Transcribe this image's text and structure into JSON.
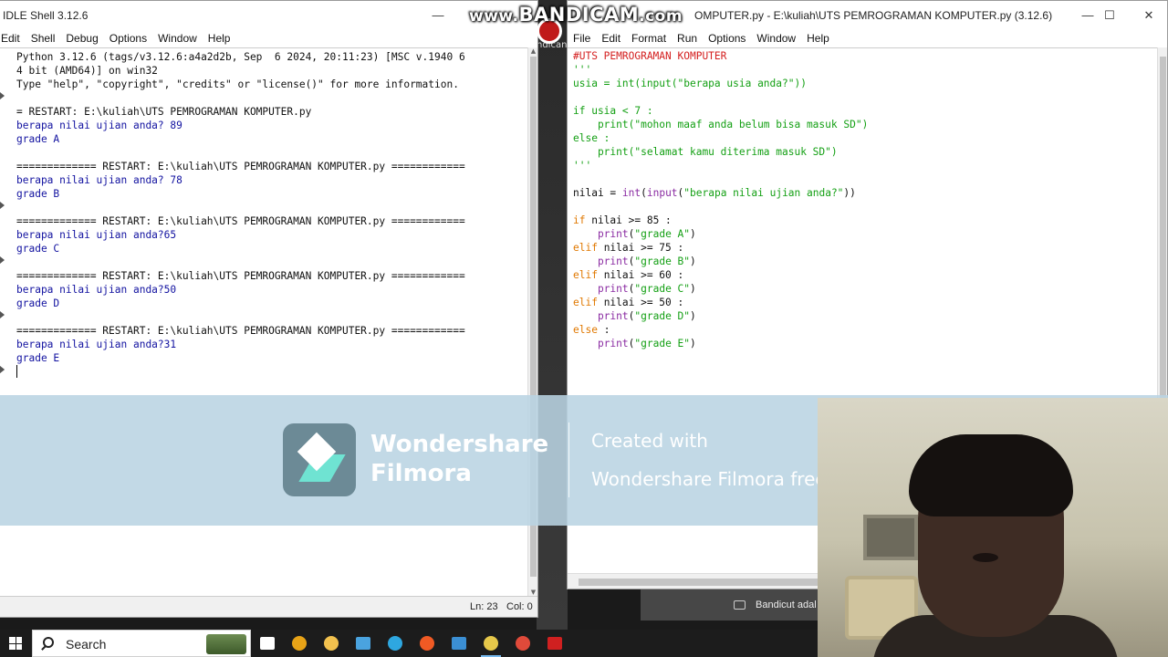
{
  "shell_window": {
    "title": "IDLE Shell 3.12.6",
    "menu": [
      "Edit",
      "Shell",
      "Debug",
      "Options",
      "Window",
      "Help"
    ],
    "lines": [
      {
        "text": "Python 3.12.6 (tags/v3.12.6:a4a2d2b, Sep  6 2024, 20:11:23) [MSC v.1940 6",
        "cls": "c-out"
      },
      {
        "text": "4 bit (AMD64)] on win32",
        "cls": "c-out"
      },
      {
        "text": "Type \"help\", \"copyright\", \"credits\" or \"license()\" for more information.",
        "cls": "c-out"
      },
      {
        "text": "",
        "cls": "c-out"
      },
      {
        "text": "= RESTART: E:\\kuliah\\UTS PEMROGRAMAN KOMPUTER.py",
        "cls": "c-out"
      },
      {
        "text": "berapa nilai ujian anda? 89",
        "cls": "c-blue"
      },
      {
        "text": "grade A",
        "cls": "c-blue"
      },
      {
        "text": "",
        "cls": "c-out"
      },
      {
        "text": "============= RESTART: E:\\kuliah\\UTS PEMROGRAMAN KOMPUTER.py ============",
        "cls": "c-out"
      },
      {
        "text": "berapa nilai ujian anda? 78",
        "cls": "c-blue"
      },
      {
        "text": "grade B",
        "cls": "c-blue"
      },
      {
        "text": "",
        "cls": "c-out"
      },
      {
        "text": "============= RESTART: E:\\kuliah\\UTS PEMROGRAMAN KOMPUTER.py ============",
        "cls": "c-out"
      },
      {
        "text": "berapa nilai ujian anda?65",
        "cls": "c-blue"
      },
      {
        "text": "grade C",
        "cls": "c-blue"
      },
      {
        "text": "",
        "cls": "c-out"
      },
      {
        "text": "============= RESTART: E:\\kuliah\\UTS PEMROGRAMAN KOMPUTER.py ============",
        "cls": "c-out"
      },
      {
        "text": "berapa nilai ujian anda?50",
        "cls": "c-blue"
      },
      {
        "text": "grade D",
        "cls": "c-blue"
      },
      {
        "text": "",
        "cls": "c-out"
      },
      {
        "text": "============= RESTART: E:\\kuliah\\UTS PEMROGRAMAN KOMPUTER.py ============",
        "cls": "c-out"
      },
      {
        "text": "berapa nilai ujian anda?31",
        "cls": "c-blue"
      },
      {
        "text": "grade E",
        "cls": "c-blue"
      }
    ],
    "status": {
      "line": "Ln: 23",
      "col": "Col: 0"
    }
  },
  "editor_window": {
    "title": "OMPUTER.py - E:\\kuliah\\UTS PEMROGRAMAN KOMPUTER.py (3.12.6)",
    "menu": [
      "File",
      "Edit",
      "Format",
      "Run",
      "Options",
      "Window",
      "Help"
    ],
    "code": [
      [
        {
          "t": "#UTS PEMROGRAMAN KOMPUTER",
          "c": "k-red"
        }
      ],
      [
        {
          "t": "'''",
          "c": "k-str"
        }
      ],
      [
        {
          "t": "usia = int(input(\"berapa usia anda?\"))",
          "c": "k-str"
        }
      ],
      [],
      [
        {
          "t": "if usia < 7 :",
          "c": "k-str"
        }
      ],
      [
        {
          "t": "    print(\"mohon maaf anda belum bisa masuk SD\")",
          "c": "k-str"
        }
      ],
      [
        {
          "t": "else :",
          "c": "k-str"
        }
      ],
      [
        {
          "t": "    print(\"selamat kamu diterima masuk SD\")",
          "c": "k-str"
        }
      ],
      [
        {
          "t": "'''",
          "c": "k-str"
        }
      ],
      [],
      [
        {
          "t": "nilai = ",
          "c": "k-def"
        },
        {
          "t": "int",
          "c": "k-blt"
        },
        {
          "t": "(",
          "c": "k-def"
        },
        {
          "t": "input",
          "c": "k-blt"
        },
        {
          "t": "(",
          "c": "k-def"
        },
        {
          "t": "\"berapa nilai ujian anda?\"",
          "c": "k-str"
        },
        {
          "t": "))",
          "c": "k-def"
        }
      ],
      [],
      [
        {
          "t": "if",
          "c": "k-kw"
        },
        {
          "t": " nilai >= 85 :",
          "c": "k-def"
        }
      ],
      [
        {
          "t": "    ",
          "c": "k-def"
        },
        {
          "t": "print",
          "c": "k-blt"
        },
        {
          "t": "(",
          "c": "k-def"
        },
        {
          "t": "\"grade A\"",
          "c": "k-str"
        },
        {
          "t": ")",
          "c": "k-def"
        }
      ],
      [
        {
          "t": "elif",
          "c": "k-kw"
        },
        {
          "t": " nilai >= 75 :",
          "c": "k-def"
        }
      ],
      [
        {
          "t": "    ",
          "c": "k-def"
        },
        {
          "t": "print",
          "c": "k-blt"
        },
        {
          "t": "(",
          "c": "k-def"
        },
        {
          "t": "\"grade B\"",
          "c": "k-str"
        },
        {
          "t": ")",
          "c": "k-def"
        }
      ],
      [
        {
          "t": "elif",
          "c": "k-kw"
        },
        {
          "t": " nilai >= 60 :",
          "c": "k-def"
        }
      ],
      [
        {
          "t": "    ",
          "c": "k-def"
        },
        {
          "t": "print",
          "c": "k-blt"
        },
        {
          "t": "(",
          "c": "k-def"
        },
        {
          "t": "\"grade C\"",
          "c": "k-str"
        },
        {
          "t": ")",
          "c": "k-def"
        }
      ],
      [
        {
          "t": "elif",
          "c": "k-kw"
        },
        {
          "t": " nilai >= 50 :",
          "c": "k-def"
        }
      ],
      [
        {
          "t": "    ",
          "c": "k-def"
        },
        {
          "t": "print",
          "c": "k-blt"
        },
        {
          "t": "(",
          "c": "k-def"
        },
        {
          "t": "\"grade D\"",
          "c": "k-str"
        },
        {
          "t": ")",
          "c": "k-def"
        }
      ],
      [
        {
          "t": "else",
          "c": "k-kw"
        },
        {
          "t": " :",
          "c": "k-def"
        }
      ],
      [
        {
          "t": "    ",
          "c": "k-def"
        },
        {
          "t": "print",
          "c": "k-blt"
        },
        {
          "t": "(",
          "c": "k-def"
        },
        {
          "t": "\"grade E\"",
          "c": "k-str"
        },
        {
          "t": ")",
          "c": "k-def"
        }
      ]
    ]
  },
  "watermark": {
    "prefix": "www.",
    "brand": "BANDICAM",
    "suffix": ".com"
  },
  "filmora": {
    "name_line1": "Wondershare",
    "name_line2": "Filmora",
    "created": "Created with",
    "plan": "Wondershare Filmora free plan"
  },
  "notification": {
    "text": "Bandicut adal"
  },
  "background_hint": "ndican",
  "taskbar": {
    "search_label": "Search",
    "apps": [
      {
        "name": "task-view-icon",
        "color": "#ffffff"
      },
      {
        "name": "chrome-icon",
        "color": "#e8a317"
      },
      {
        "name": "file-explorer-icon",
        "color": "#f2c14e"
      },
      {
        "name": "store-icon",
        "color": "#4aa3df"
      },
      {
        "name": "edge-icon",
        "color": "#2ea7e0"
      },
      {
        "name": "brave-icon",
        "color": "#f05a24"
      },
      {
        "name": "mail-icon",
        "color": "#3b8fd4"
      },
      {
        "name": "idle-python-icon",
        "color": "#e6c84a"
      },
      {
        "name": "chrome-alt-icon",
        "color": "#e04a3a"
      },
      {
        "name": "bandicam-icon",
        "color": "#d02020"
      }
    ]
  },
  "colors": {
    "shell_output_blue": "#1212a0",
    "editor_string_green": "#14a014",
    "editor_keyword_orange": "#e07800",
    "editor_builtin_purple": "#8a2ba2",
    "editor_comment_red": "#d42020",
    "banner_bg": "#b9d4e2"
  }
}
